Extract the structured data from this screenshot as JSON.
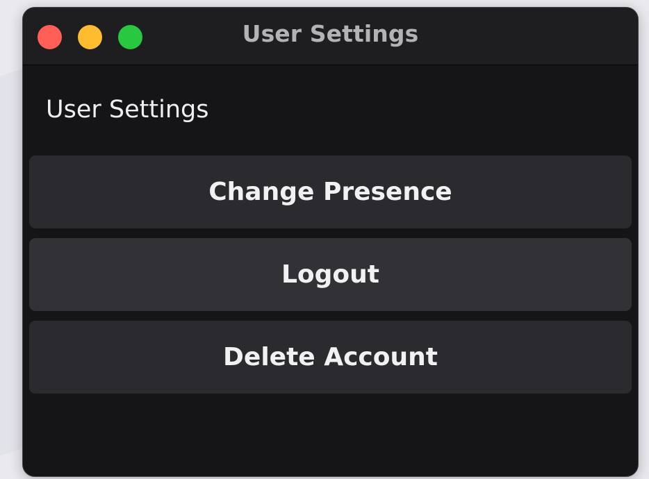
{
  "window": {
    "title": "User Settings"
  },
  "content": {
    "heading": "User Settings",
    "buttons": [
      {
        "label": "Change Presence"
      },
      {
        "label": "Logout"
      },
      {
        "label": "Delete Account"
      }
    ]
  },
  "colors": {
    "window_background": "#151517",
    "titlebar_background": "#1e1e20",
    "button_background": "#2b2b2f",
    "close": "#ff5f57",
    "minimize": "#febc2e",
    "zoom": "#28c840"
  },
  "icons": {
    "close": "close-window-icon",
    "minimize": "minimize-window-icon",
    "zoom": "zoom-window-icon"
  }
}
